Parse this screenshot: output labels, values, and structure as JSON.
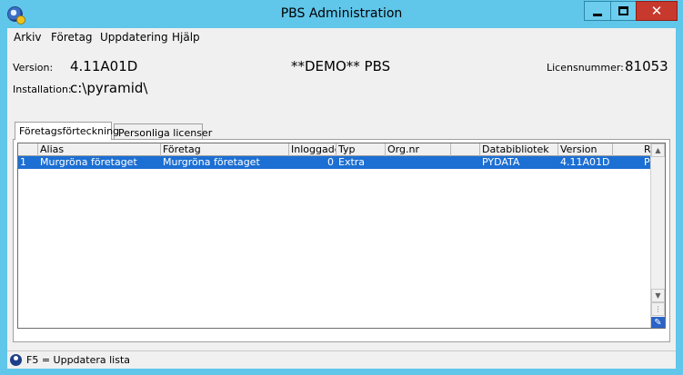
{
  "window": {
    "title": "PBS Administration",
    "minimize_icon": "minimize-icon",
    "maximize_icon": "maximize-icon",
    "close_icon": "close-icon",
    "close_glyph": "✕"
  },
  "menu": {
    "items": [
      "Arkiv",
      "Företag",
      "Uppdatering",
      "Hjälp"
    ]
  },
  "info": {
    "version_label": "Version:",
    "version_value": "4.11A01D",
    "installation_label": "Installation:",
    "installation_value": "c:\\pyramid\\",
    "demo_text": "**DEMO** PBS",
    "license_label": "Licensnummer:",
    "license_value": "81053"
  },
  "tabs": [
    {
      "label": "Företagsförteckning",
      "active": true
    },
    {
      "label": "Personliga licenser",
      "active": false
    }
  ],
  "grid": {
    "columns": [
      "",
      "Alias",
      "Företag",
      "Inloggade",
      "Typ",
      "Org.nr",
      "",
      "Databibliotek",
      "Version",
      "R"
    ],
    "rows": [
      {
        "index": "1",
        "alias": "Murgröna företaget",
        "foretag": "Murgröna företaget",
        "inloggade": "0",
        "typ": "Extra",
        "orgnr": "",
        "blank": "",
        "databibliotek": "PYDATA",
        "version": "4.11A01D",
        "r": "P"
      }
    ],
    "selection_color": "#1c6fd3"
  },
  "statusbar": {
    "text": "F5 = Uppdatera lista"
  },
  "colors": {
    "titlebar": "#60c6ea",
    "close_button": "#c7382d"
  }
}
